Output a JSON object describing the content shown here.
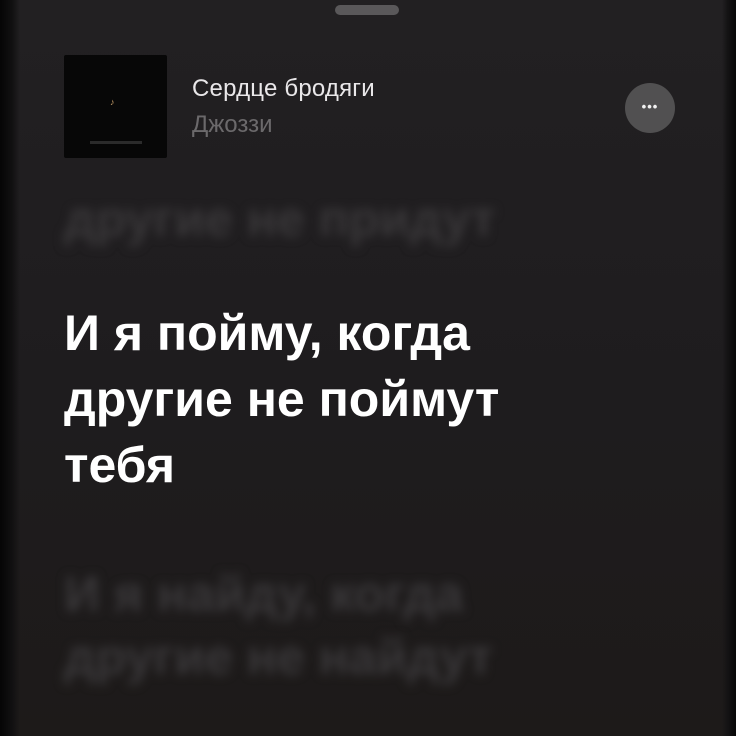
{
  "track": {
    "title": "Сердце бродяги",
    "artist": "Джоззи",
    "cover_icon": "album-cover-art"
  },
  "actions": {
    "more_label": "•••",
    "more_icon": "ellipsis-icon"
  },
  "lyrics": {
    "previous": "другие не придут",
    "current": [
      "И я пойму, когда",
      "другие не поймут",
      "тебя"
    ],
    "next": [
      "И я найду, когда",
      "другие не найдут"
    ]
  },
  "colors": {
    "background": "#1e1c1e",
    "active_lyric": "#ffffff",
    "inactive_lyric": "#3a383a",
    "artist_text": "#6b696b",
    "more_button": "#515051"
  }
}
